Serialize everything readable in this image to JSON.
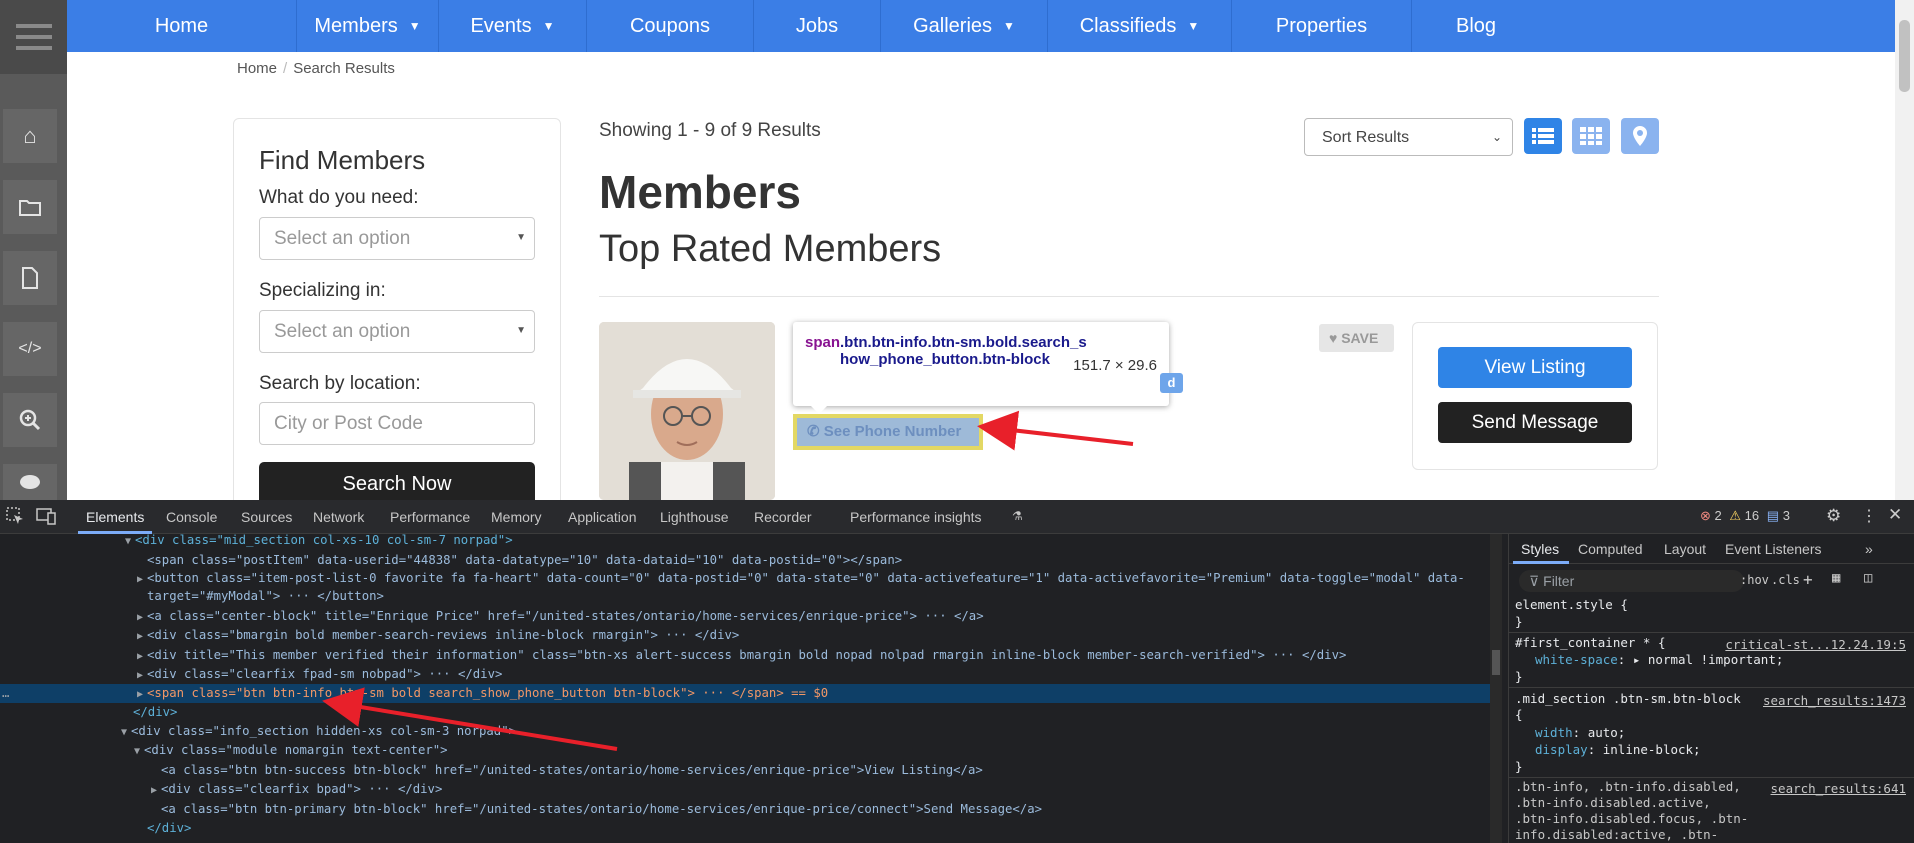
{
  "nav": {
    "items": [
      {
        "label": "Home",
        "caret": false
      },
      {
        "label": "Members",
        "caret": true
      },
      {
        "label": "Events",
        "caret": true
      },
      {
        "label": "Coupons",
        "caret": false
      },
      {
        "label": "Jobs",
        "caret": false
      },
      {
        "label": "Galleries",
        "caret": true
      },
      {
        "label": "Classifieds",
        "caret": true
      },
      {
        "label": "Properties",
        "caret": false
      },
      {
        "label": "Blog",
        "caret": false
      }
    ]
  },
  "sidebar": {
    "icons": [
      "menu-icon",
      "home-icon",
      "folder-icon",
      "file-icon",
      "code-icon",
      "search-icon",
      "chat-icon"
    ]
  },
  "breadcrumb": {
    "home": "Home",
    "current": "Search Results"
  },
  "find": {
    "title": "Find Members",
    "need_label": "What do you need:",
    "need_placeholder": "Select an option",
    "specializing_label": "Specializing in:",
    "specializing_placeholder": "Select an option",
    "location_label": "Search by location:",
    "location_placeholder": "City or Post Code",
    "search_button": "Search Now"
  },
  "results": {
    "showing": "Showing 1 - 9 of 9 Results",
    "sort_label": "Sort Results",
    "heading": "Members",
    "subheading": "Top Rated Members"
  },
  "member": {
    "save_label": "SAVE",
    "phone_button": "See Phone Number",
    "verified_peek": "d",
    "view_listing": "View Listing",
    "send_message": "Send Message"
  },
  "tooltip": {
    "tag": "span",
    "selector": ".btn.btn-info.btn-sm.bold.search_show_phone_button.btn-block",
    "dims": "151.7 × 29.6"
  },
  "devtools": {
    "tabs": [
      "Elements",
      "Console",
      "Sources",
      "Network",
      "Performance",
      "Memory",
      "Application",
      "Lighthouse",
      "Recorder",
      "Performance insights"
    ],
    "errors": "2",
    "warnings": "16",
    "messages": "3",
    "styles_tabs": [
      "Styles",
      "Computed",
      "Layout",
      "Event Listeners"
    ],
    "filter_placeholder": "Filter",
    "hov": ":hov",
    "cls": ".cls",
    "dom_lines": [
      "<div class=\"mid_section col-xs-10 col-sm-7 norpad\">",
      "<span class=\"postItem\" data-userid=\"44838\" data-datatype=\"10\" data-dataid=\"10\" data-postid=\"0\"></span>",
      "<button class=\"item-post-list-0 favorite fa fa-heart\" data-count=\"0\" data-postid=\"0\" data-state=\"0\" data-activefeature=\"1\" data-activefavorite=\"Premium\" data-toggle=\"modal\" data-",
      "target=\"#myModal\"> ··· </button>",
      "<a class=\"center-block\" title=\"Enrique Price\" href=\"/united-states/ontario/home-services/enrique-price\"> ··· </a>",
      "<div class=\"bmargin bold member-search-reviews inline-block rmargin\"> ··· </div>",
      "<div title=\"This member verified their information\" class=\"btn-xs alert-success bmargin bold nopad nolpad rmargin inline-block member-search-verified\"> ··· </div>",
      "<div class=\"clearfix fpad-sm nobpad\"> ··· </div>",
      "<span class=\"btn btn-info btn-sm bold search_show_phone_button btn-block\"> ··· </span> == $0",
      "</div>",
      "<div class=\"info_section hidden-xs col-sm-3 norpad\">",
      "<div class=\"module nomargin text-center\">",
      "<a class=\"btn btn-success btn-block\" href=\"/united-states/ontario/home-services/enrique-price\">View Listing</a>",
      "<div class=\"clearfix bpad\"> ··· </div>",
      "<a class=\"btn btn-primary btn-block\" href=\"/united-states/ontario/home-services/enrique-price/connect\">Send Message</a>",
      "</div>"
    ],
    "styles": [
      {
        "selector": "element.style {",
        "src": ""
      },
      {
        "selector": "#first_container * {",
        "src": "critical-st...12.24.19:5",
        "props": [
          [
            "white-space",
            "▸ normal !important;"
          ]
        ]
      },
      {
        "selector": ".mid_section .btn-sm.btn-block {",
        "src": "search_results:1473",
        "props": [
          [
            "width",
            "auto;"
          ],
          [
            "display",
            "inline-block;"
          ]
        ]
      },
      {
        "selector": ".btn-info, .btn-info.disabled, .btn-info.disabled.active, .btn-info.disabled.focus, .btn-info.disabled:active, .btn-info.disabled:focus,",
        "src": "search_results:641"
      }
    ]
  }
}
